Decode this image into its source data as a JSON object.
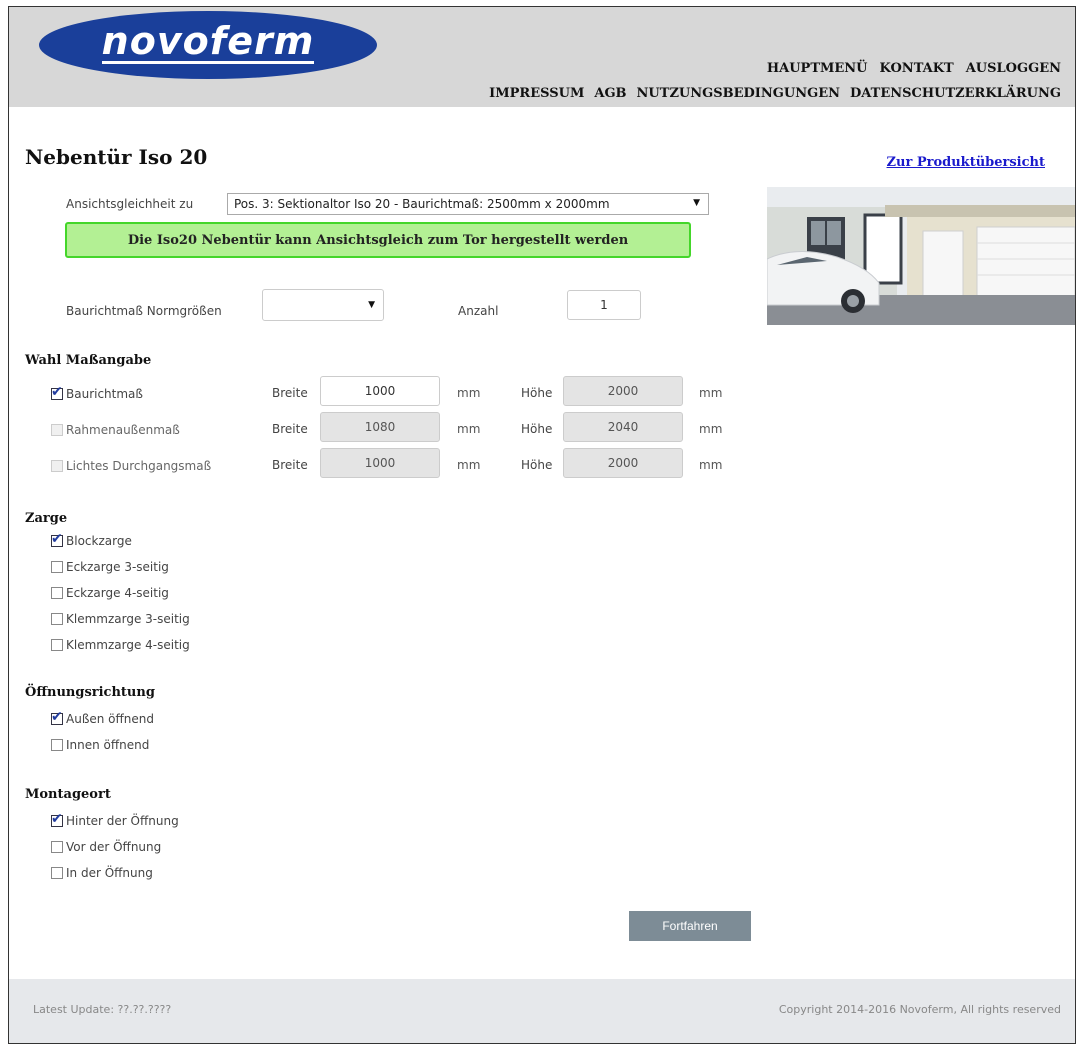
{
  "header": {
    "logo_text": "novoferm",
    "nav_top": [
      "HAUPTMENÜ",
      "KONTAKT",
      "AUSLOGGEN"
    ],
    "nav_bottom": [
      "IMPRESSUM",
      "AGB",
      "NUTZUNGSBEDINGUNGEN",
      "DATENSCHUTZERKLÄRUNG"
    ]
  },
  "page": {
    "title": "Nebentür Iso 20",
    "overview_link": "Zur Produktübersicht"
  },
  "ansicht": {
    "label": "Ansichtsgleichheit zu",
    "selected": "Pos. 3: Sektionaltor Iso 20 - Baurichtmaß: 2500mm x 2000mm",
    "notice": "Die Iso20 Nebentür kann Ansichtsgleich zum Tor hergestellt werden"
  },
  "norm": {
    "label": "Baurichtmaß Normgrößen",
    "selected": "",
    "anzahl_label": "Anzahl",
    "anzahl_value": "1"
  },
  "masse": {
    "section_title": "Wahl Maßangabe",
    "breite_label": "Breite",
    "hoehe_label": "Höhe",
    "unit": "mm",
    "rows": [
      {
        "label": "Baurichtmaß",
        "checked": true,
        "breite": "1000",
        "hoehe": "2000"
      },
      {
        "label": "Rahmenaußenmaß",
        "checked": false,
        "breite": "1080",
        "hoehe": "2040"
      },
      {
        "label": "Lichtes Durchgangsmaß",
        "checked": false,
        "breite": "1000",
        "hoehe": "2000"
      }
    ]
  },
  "zarge": {
    "section_title": "Zarge",
    "options": [
      "Blockzarge",
      "Eckzarge 3-seitig",
      "Eckzarge 4-seitig",
      "Klemmzarge 3-seitig",
      "Klemmzarge 4-seitig"
    ]
  },
  "oeffnung": {
    "section_title": "Öffnungsrichtung",
    "options": [
      "Außen öffnend",
      "Innen öffnend"
    ]
  },
  "montage": {
    "section_title": "Montageort",
    "options": [
      "Hinter der Öffnung",
      "Vor der Öffnung",
      "In der Öffnung"
    ]
  },
  "actions": {
    "continue_label": "Fortfahren"
  },
  "footer": {
    "update": "Latest Update: ??.??.????",
    "copyright": "Copyright 2014-2016 Novoferm, All rights reserved"
  },
  "colors": {
    "header_bg": "#d7d7d7",
    "logo_blue": "#1a3f9a",
    "notice_bg": "#b3f094",
    "notice_border": "#44d62a",
    "link": "#1a1acc",
    "button": "#7d8c96"
  }
}
